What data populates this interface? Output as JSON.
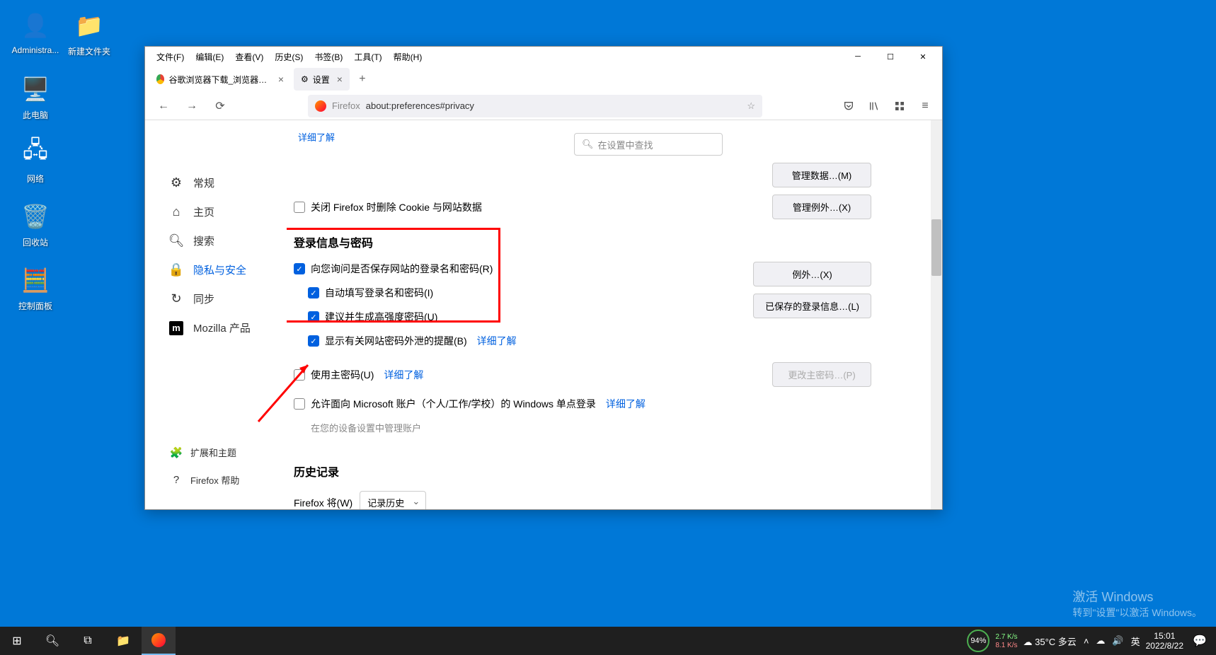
{
  "desktop": {
    "icons": [
      {
        "label": "Administra...",
        "emoji": "👤"
      },
      {
        "label": "新建文件夹",
        "emoji": "📁"
      },
      {
        "label": "此电脑",
        "emoji": "🖥️"
      },
      {
        "label": "网络",
        "emoji": "🖧"
      },
      {
        "label": "回收站",
        "emoji": "🗑️"
      },
      {
        "label": "控制面板",
        "emoji": "🧮"
      }
    ]
  },
  "window": {
    "menus": [
      "文件(F)",
      "编辑(E)",
      "查看(V)",
      "历史(S)",
      "书签(B)",
      "工具(T)",
      "帮助(H)"
    ],
    "tabs": [
      {
        "title": "谷歌浏览器下载_浏览器官网入[...",
        "active": false
      },
      {
        "title": "设置",
        "active": true
      }
    ],
    "url_prefix": "Firefox",
    "url_path": "about:preferences#privacy"
  },
  "settings": {
    "search_placeholder": "在设置中查找",
    "nav": [
      {
        "label": "常规"
      },
      {
        "label": "主页"
      },
      {
        "label": "搜索"
      },
      {
        "label": "隐私与安全",
        "active": true
      },
      {
        "label": "同步"
      },
      {
        "label": "Mozilla 产品"
      }
    ],
    "nav_bottom": [
      {
        "label": "扩展和主题"
      },
      {
        "label": "Firefox 帮助"
      }
    ],
    "truncated_top": "详细了解",
    "buttons": {
      "manage_data": "管理数据…(M)",
      "manage_exceptions": "管理例外…(X)",
      "exceptions": "例外…(X)",
      "saved_logins": "已保存的登录信息…(L)",
      "change_master": "更改主密码…(P)"
    },
    "cookies_close_label": "关闭 Firefox 时删除 Cookie 与网站数据",
    "section_passwords": "登录信息与密码",
    "passwords": {
      "ask_save": "向您询问是否保存网站的登录名和密码(R)",
      "autofill": "自动填写登录名和密码(I)",
      "suggest": "建议并生成高强度密码(U)",
      "breach": "显示有关网站密码外泄的提醒(B)",
      "master": "使用主密码(U)",
      "sso": "允许面向 Microsoft 账户（个人/工作/学校）的 Windows 单点登录",
      "learn_more": "详细了解",
      "device_note": "在您的设备设置中管理账户"
    },
    "section_history": "历史记录",
    "history_label": "Firefox 将(W)",
    "history_select": "记录历史"
  },
  "taskbar": {
    "weather": "35°C 多云",
    "perf": "94%",
    "net_up": "2.7 K/s",
    "net_down": "8.1 K/s",
    "ime": "英",
    "time": "15:01",
    "date": "2022/8/22"
  },
  "watermark": {
    "title": "激活 Windows",
    "sub": "转到\"设置\"以激活 Windows。"
  }
}
